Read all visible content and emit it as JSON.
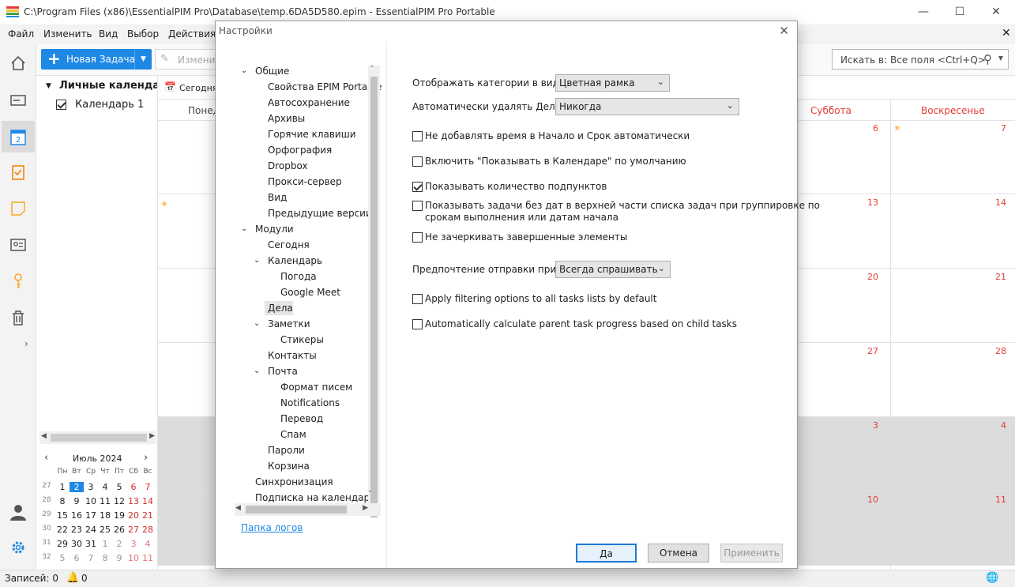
{
  "app": {
    "title": "C:\\Program Files (x86)\\EssentialPIM Pro\\Database\\temp.6DA5D580.epim - EssentialPIM Pro Portable"
  },
  "menu": [
    "Файл",
    "Изменить",
    "Вид",
    "Выбор",
    "Действия"
  ],
  "toolbar": {
    "new_task": "Новая Задача",
    "edit": "Изменит",
    "search_placeholder": "Искать в: Все поля  <Ctrl+Q>"
  },
  "calendar_pane": {
    "group": "Личные календари",
    "item": "Календарь 1",
    "today_btn": "Сегодня",
    "col_mon": "Понед"
  },
  "mini_calendar": {
    "month": "Июль  2024",
    "weekdays": [
      "Пн",
      "Вт",
      "Ср",
      "Чт",
      "Пт",
      "Сб",
      "Вс"
    ],
    "weeks": [
      [
        "27",
        "1",
        "2",
        "3",
        "4",
        "5",
        "6",
        "7"
      ],
      [
        "28",
        "8",
        "9",
        "10",
        "11",
        "12",
        "13",
        "14"
      ],
      [
        "29",
        "15",
        "16",
        "17",
        "18",
        "19",
        "20",
        "21"
      ],
      [
        "30",
        "22",
        "23",
        "24",
        "25",
        "26",
        "27",
        "28"
      ],
      [
        "31",
        "29",
        "30",
        "31",
        "1",
        "2",
        "3",
        "4"
      ],
      [
        "32",
        "5",
        "6",
        "7",
        "8",
        "9",
        "10",
        "11"
      ]
    ]
  },
  "calendar": {
    "sat": "Суббота",
    "sun": "Воскресенье",
    "sat_days": [
      "6",
      "13",
      "20",
      "27",
      "3",
      "10"
    ],
    "sun_days": [
      "7",
      "14",
      "21",
      "28",
      "4",
      "11"
    ]
  },
  "status": {
    "records": "Записей: 0",
    "notifications": "0"
  },
  "dialog": {
    "title": "Настройки",
    "tree": [
      {
        "label": "Общие",
        "level": 0,
        "expanded": true
      },
      {
        "label": "Свойства EPIM Portable",
        "level": 1
      },
      {
        "label": "Автосохранение",
        "level": 1
      },
      {
        "label": "Архивы",
        "level": 1
      },
      {
        "label": "Горячие клавиши",
        "level": 1
      },
      {
        "label": "Орфография",
        "level": 1
      },
      {
        "label": "Dropbox",
        "level": 1
      },
      {
        "label": "Прокси-сервер",
        "level": 1
      },
      {
        "label": "Вид",
        "level": 1
      },
      {
        "label": "Предыдущие версии",
        "level": 1
      },
      {
        "label": "Модули",
        "level": 0,
        "expanded": true
      },
      {
        "label": "Сегодня",
        "level": 1
      },
      {
        "label": "Календарь",
        "level": 1,
        "expanded": true
      },
      {
        "label": "Погода",
        "level": 2
      },
      {
        "label": "Google Meet",
        "level": 2
      },
      {
        "label": "Дела",
        "level": 1,
        "selected": true
      },
      {
        "label": "Заметки",
        "level": 1,
        "expanded": true
      },
      {
        "label": "Стикеры",
        "level": 2
      },
      {
        "label": "Контакты",
        "level": 1
      },
      {
        "label": "Почта",
        "level": 1,
        "expanded": true
      },
      {
        "label": "Формат писем",
        "level": 2
      },
      {
        "label": "Notifications",
        "level": 2
      },
      {
        "label": "Перевод",
        "level": 2
      },
      {
        "label": "Спам",
        "level": 2
      },
      {
        "label": "Пароли",
        "level": 1
      },
      {
        "label": "Корзина",
        "level": 1
      },
      {
        "label": "Синхронизация",
        "level": 0
      },
      {
        "label": "Подписка на календарь",
        "level": 0
      }
    ],
    "logs_link": "Папка логов",
    "show_categories_label": "Отображать категории в виде:",
    "show_categories_value": "Цветная рамка",
    "auto_delete_label": "Автоматически удалять Дела:",
    "auto_delete_value": "Никогда",
    "checks": [
      {
        "label": "Не добавлять время в Начало и Срок автоматически",
        "checked": false
      },
      {
        "label": "Включить \"Показывать в Календаре\" по умолчанию",
        "checked": false
      },
      {
        "label": "Показывать количество подпунктов",
        "checked": true
      },
      {
        "label": "Показывать задачи без дат в верхней части списка задач при группировке по",
        "label2": "срокам выполнения или датам начала",
        "checked": false
      },
      {
        "label": "Не зачеркивать завершенные элементы",
        "checked": false
      }
    ],
    "invite_label": "Предпочтение отправки пригла",
    "invite_value": "Всегда спрашивать",
    "checks2": [
      {
        "label": "Apply filtering options to all tasks lists by default",
        "checked": false
      },
      {
        "label": "Automatically calculate parent task progress based on child tasks",
        "checked": false
      }
    ],
    "ok": "Да",
    "cancel": "Отмена",
    "apply": "Применить"
  }
}
